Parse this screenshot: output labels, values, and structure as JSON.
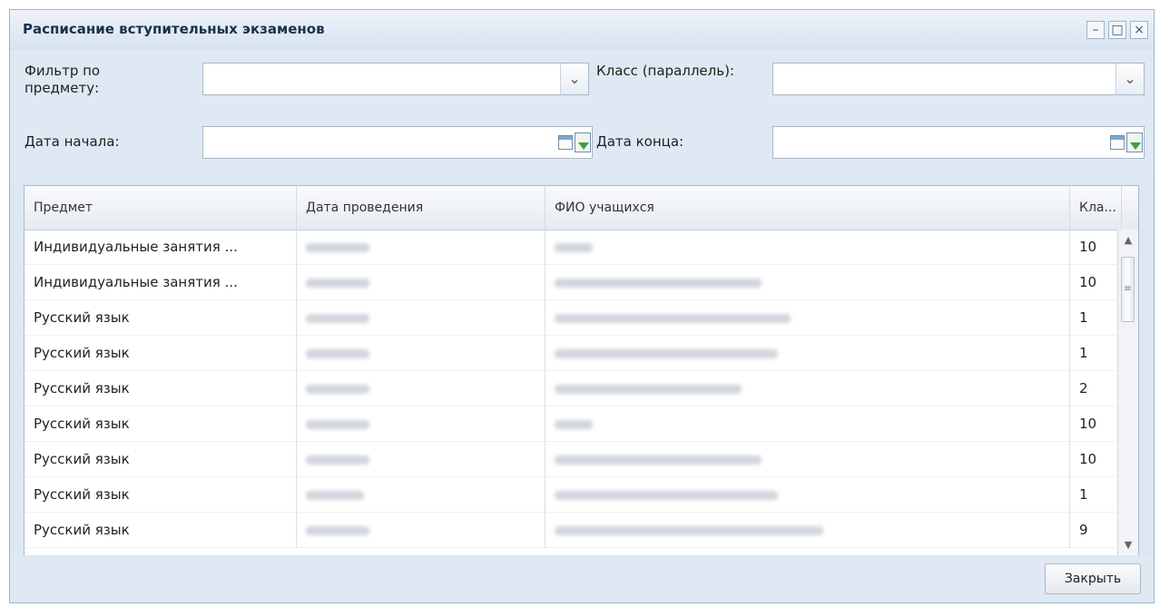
{
  "window": {
    "title": "Расписание вступительных экзаменов"
  },
  "filters": {
    "subject_label": "Фильтр по предмету:",
    "class_label": "Класс (параллель):",
    "start_label": "Дата начала:",
    "end_label": "Дата конца:",
    "subject_value": "",
    "class_value": "",
    "start_value": "",
    "end_value": ""
  },
  "grid": {
    "columns": [
      "Предмет",
      "Дата проведения",
      "ФИО учащихся",
      "Кла..."
    ],
    "rows": [
      {
        "subject": "Индивидуальные занятия ...",
        "class": "10"
      },
      {
        "subject": "Индивидуальные занятия ...",
        "class": "10"
      },
      {
        "subject": "Русский язык",
        "class": "1"
      },
      {
        "subject": "Русский язык",
        "class": "1"
      },
      {
        "subject": "Русский язык",
        "class": "2"
      },
      {
        "subject": "Русский язык",
        "class": "10"
      },
      {
        "subject": "Русский язык",
        "class": "10"
      },
      {
        "subject": "Русский язык",
        "class": "1"
      },
      {
        "subject": "Русский язык",
        "class": "9"
      }
    ]
  },
  "footer": {
    "close_label": "Закрыть"
  },
  "icons": {
    "minimize": "minimize-icon",
    "maximize": "maximize-icon",
    "close": "close-icon",
    "dropdown": "chevron-down-icon",
    "calendar": "calendar-icon",
    "apply_date": "calendar-apply-icon"
  }
}
